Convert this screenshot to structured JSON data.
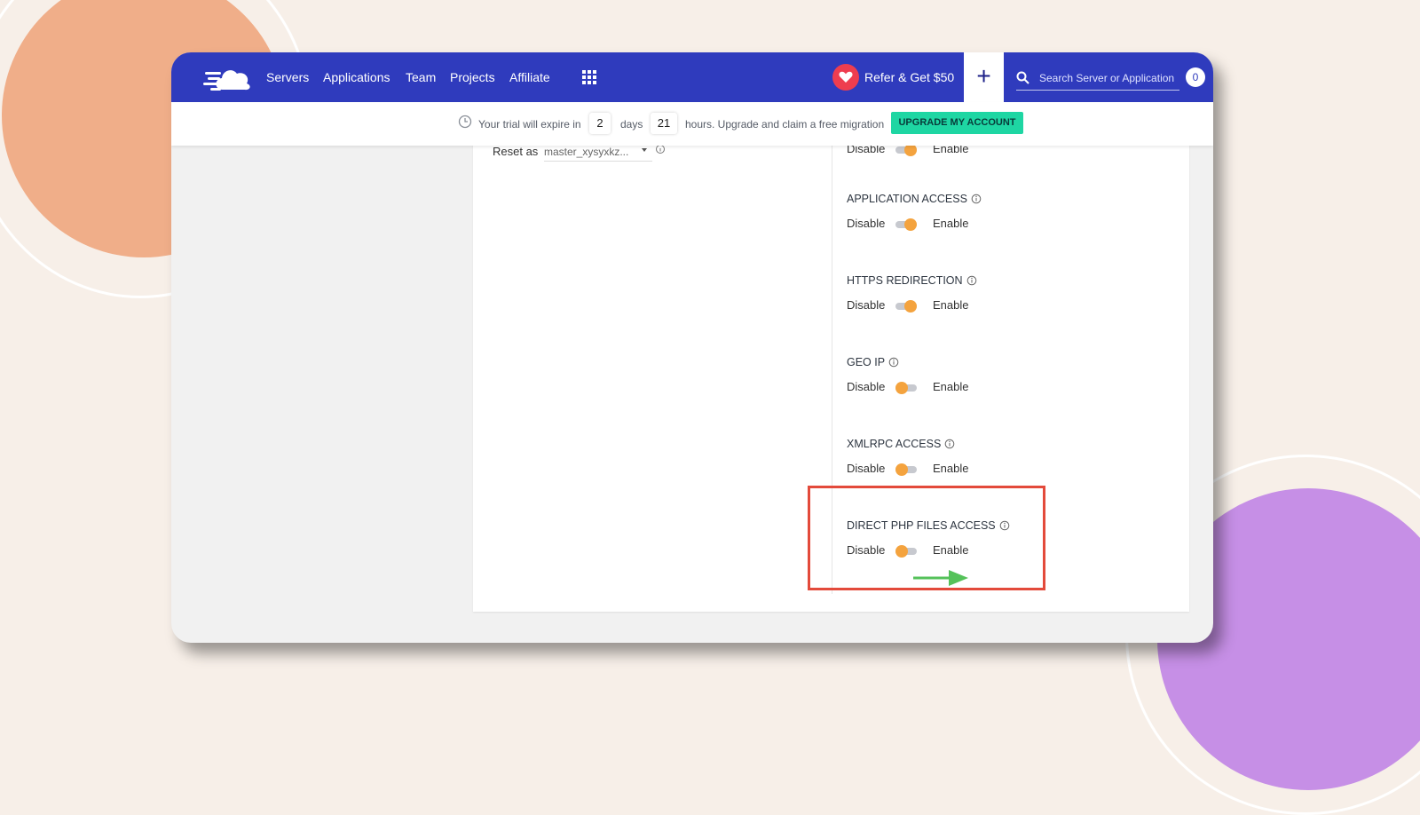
{
  "nav": {
    "items": [
      "Servers",
      "Applications",
      "Team",
      "Projects",
      "Affiliate"
    ],
    "refer_label": "Refer & Get $50",
    "add_label": "+",
    "search_placeholder": "Search Server or Application",
    "notification_count": "0"
  },
  "trial": {
    "prefix": "Your trial will expire in",
    "days_value": "2",
    "days_label": "days",
    "hours_value": "21",
    "suffix": "hours. Upgrade and claim a free migration",
    "upgrade_label": "UPGRADE MY ACCOUNT"
  },
  "reset": {
    "label": "Reset as",
    "value": "master_xysyxkz..."
  },
  "toggle_labels": {
    "disable": "Disable",
    "enable": "Enable"
  },
  "settings": [
    {
      "title": "",
      "state": "on"
    },
    {
      "title": "APPLICATION ACCESS",
      "state": "on"
    },
    {
      "title": "HTTPS REDIRECTION",
      "state": "on"
    },
    {
      "title": "GEO IP",
      "state": "off"
    },
    {
      "title": "XMLRPC ACCESS",
      "state": "off"
    },
    {
      "title": "DIRECT PHP FILES ACCESS",
      "state": "off"
    }
  ],
  "colors": {
    "nav_bg": "#2f3bbd",
    "toggle_knob": "#f4a33e",
    "upgrade_button": "#1ed6a3",
    "highlight_box": "#e34a3b",
    "arrow": "#55c25a"
  },
  "icons": [
    "cloudways-logo-icon",
    "apps-grid-icon",
    "heart-icon",
    "plus-icon",
    "search-icon",
    "clock-icon",
    "info-icon",
    "arrow-right-icon"
  ]
}
